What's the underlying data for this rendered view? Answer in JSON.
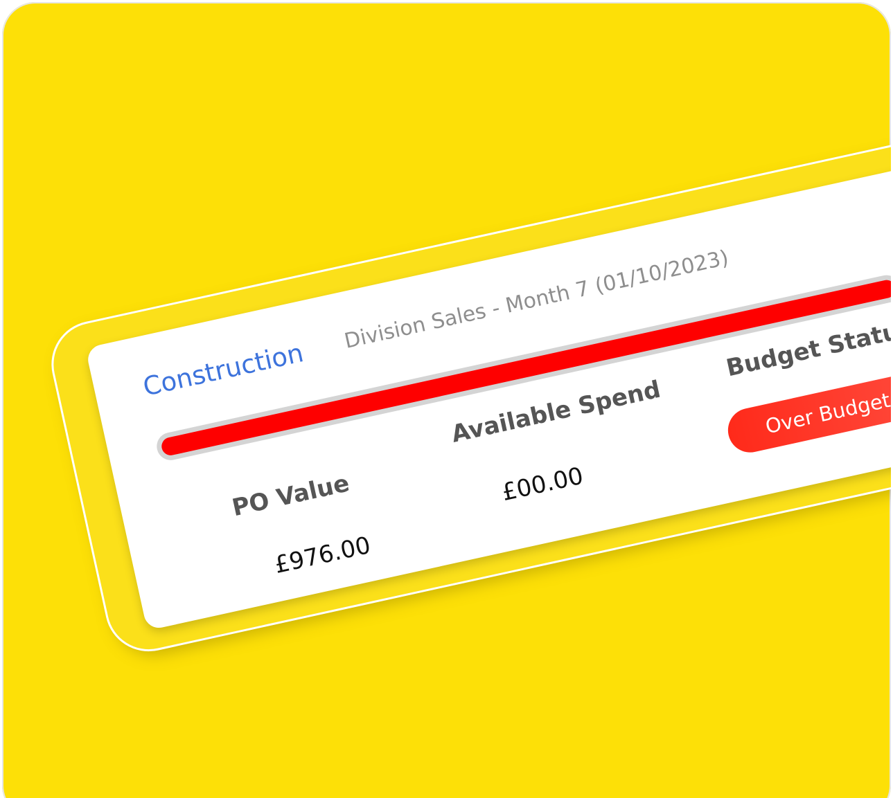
{
  "budget_card": {
    "division": "Construction",
    "period": "Division Sales - Month 7 (01/10/2023)",
    "progress_fraction": 1.0,
    "progress_color": "#fe0000",
    "metrics": [
      {
        "label": "PO Value",
        "value": "£976.00"
      },
      {
        "label": "Available Spend",
        "value": "£00.00"
      }
    ],
    "status": {
      "label": "Budget Status",
      "value": "Over Budget",
      "color": "#ff2a1a"
    }
  },
  "colors": {
    "background": "#fde007",
    "division_text": "#3d73dc"
  }
}
